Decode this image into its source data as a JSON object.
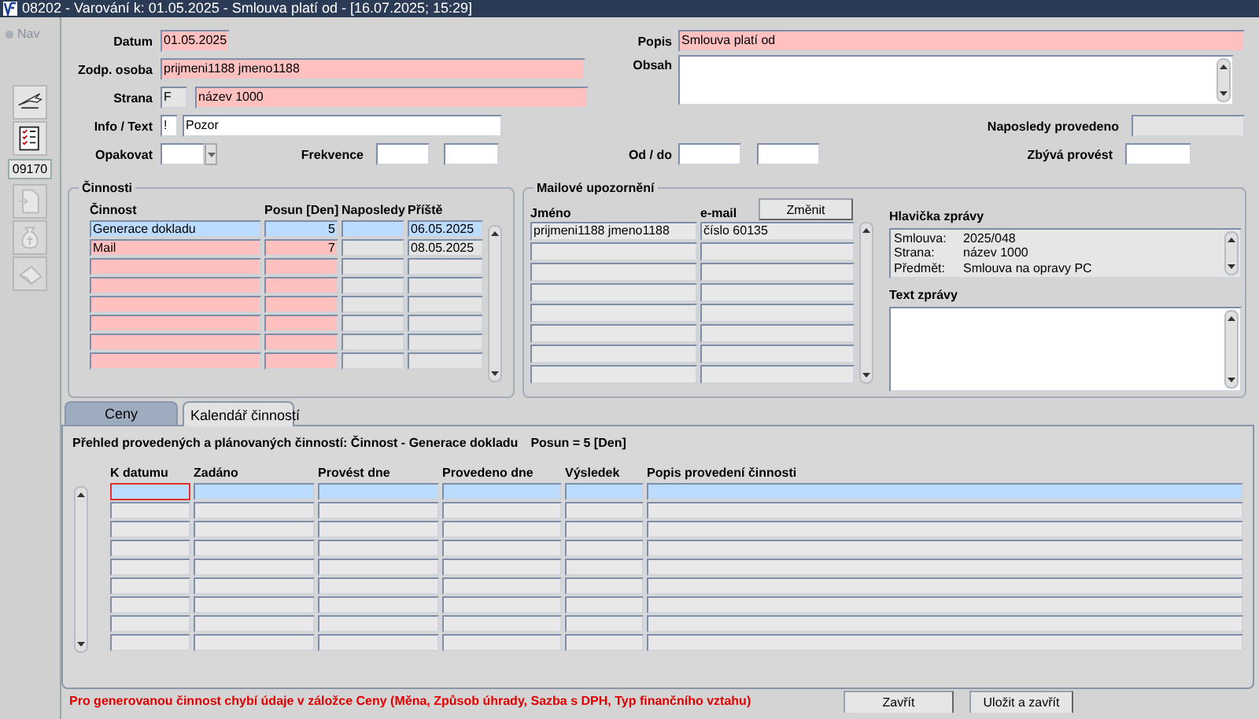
{
  "window": {
    "title": "08202 - Varování k: 01.05.2025 - Smlouva platí od - [16.07.2025; 15:29]"
  },
  "toolbar": {
    "nav_label": "Nav",
    "record_number": "09170",
    "tools_top": [
      {
        "kind": "airplane",
        "disabled": false
      },
      {
        "kind": "checklist",
        "disabled": false
      }
    ],
    "tools_bottom": [
      {
        "kind": "document",
        "disabled": true
      },
      {
        "kind": "money-bag",
        "disabled": true
      },
      {
        "kind": "hand-paper",
        "disabled": true
      }
    ]
  },
  "form": {
    "datum": {
      "label": "Datum",
      "value": "01.05.2025",
      "required": true
    },
    "zodp_osoba": {
      "label": "Zodp. osoba",
      "value": "prijmeni1188 jmeno1188",
      "required": true
    },
    "strana": {
      "label": "Strana",
      "code": "F",
      "value": "název 1000",
      "required": true
    },
    "info_text": {
      "label": "Info / Text",
      "flag": "!",
      "value": "Pozor",
      "required": false
    },
    "opakovat": {
      "label": "Opakovat"
    },
    "frekvence": {
      "label": "Frekvence"
    },
    "popis": {
      "label": "Popis",
      "value": "Smlouva platí od",
      "required": true
    },
    "obsah": {
      "label": "Obsah"
    },
    "naposledy_provedeno": {
      "label": "Naposledy provedeno",
      "disabled": true
    },
    "od_do": {
      "label": "Od / do"
    },
    "zbyva_provest": {
      "label": "Zbývá provést"
    }
  },
  "activities": {
    "title": "Činnosti",
    "columns": [
      "Činnost",
      "Posun [Den]",
      "Naposledy",
      "Příště"
    ],
    "rows": [
      {
        "activity": "Generace dokladu",
        "shift": "5",
        "next": "06.05.2025",
        "selected": true
      },
      {
        "activity": "Mail",
        "shift": "7",
        "next": "08.05.2025",
        "selected": false
      }
    ]
  },
  "mail": {
    "title": "Mailové upozornění",
    "columns": [
      "Jméno",
      "e-mail"
    ],
    "change_button": "Změnit",
    "rows": [
      {
        "name": "prijmeni1188 jmeno1188",
        "email": "číslo 60135"
      }
    ],
    "header_label": "Hlavička zprávy",
    "header_lines": [
      {
        "key": "Smlouva:",
        "value": "2025/048"
      },
      {
        "key": "Strana:",
        "value": "název 1000"
      },
      {
        "key": "Předmět:",
        "value": "Smlouva na opravy PC"
      }
    ],
    "text_label": "Text zprávy"
  },
  "tabs": [
    {
      "label": "Ceny",
      "selected": false
    },
    {
      "label": "Kalendář činností",
      "selected": true
    }
  ],
  "calendar": {
    "summary": "Přehled provedených a plánovaných činností: Činnost - Generace dokladu",
    "shift": "Posun = 5 [Den]",
    "columns": [
      "K datumu",
      "Zadáno",
      "Provést dne",
      "Provedeno dne",
      "Výsledek",
      "Popis provedení činnosti"
    ],
    "rows": [
      {
        "selected": true,
        "focused": true
      }
    ]
  },
  "footer": {
    "message": "Pro generovanou činnost chybí údaje v záložce Ceny (Měna, Způsob úhrady, Sazba s DPH, Typ finančního vztahu)",
    "buttons": [
      "Zavřít",
      "Uložit a zavřít"
    ]
  }
}
